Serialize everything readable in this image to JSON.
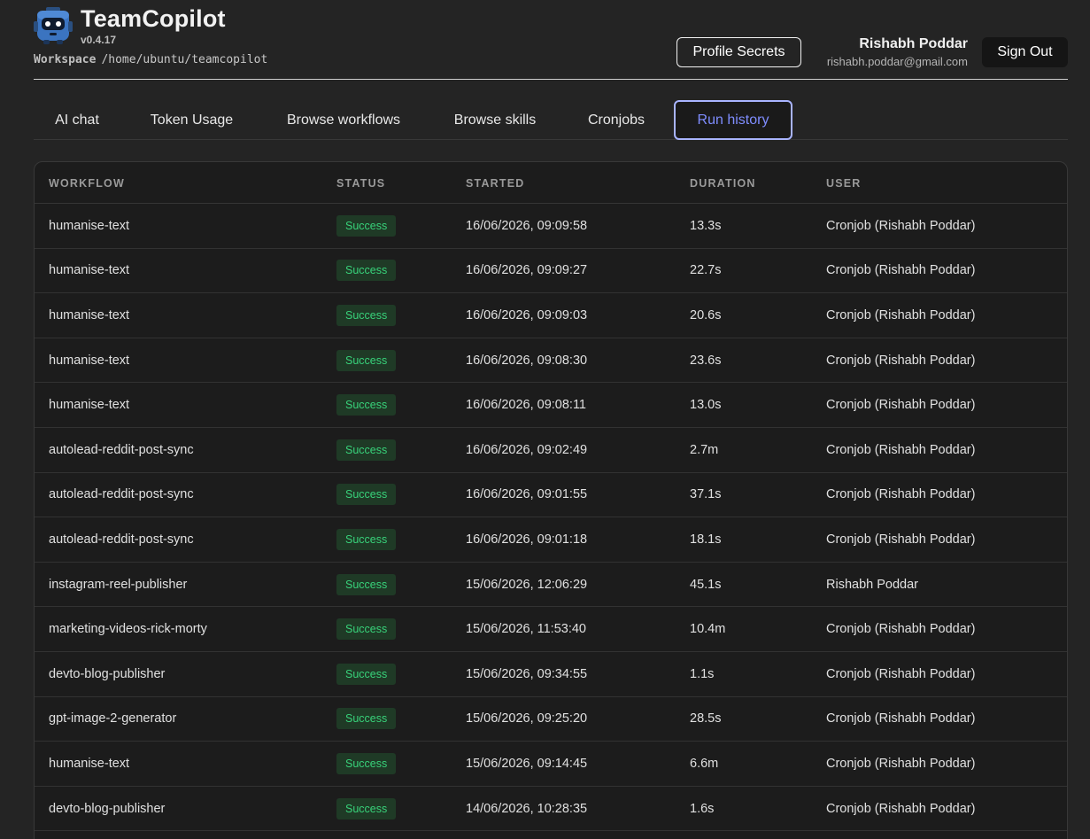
{
  "app": {
    "title": "TeamCopilot",
    "version": "v0.4.17",
    "workspace_label": "Workspace",
    "workspace_path": "/home/ubuntu/teamcopilot"
  },
  "header": {
    "profile_secrets_label": "Profile Secrets",
    "user_name": "Rishabh Poddar",
    "user_email": "rishabh.poddar@gmail.com",
    "sign_out_label": "Sign Out"
  },
  "tabs": [
    {
      "label": "AI chat",
      "active": false
    },
    {
      "label": "Token Usage",
      "active": false
    },
    {
      "label": "Browse workflows",
      "active": false
    },
    {
      "label": "Browse skills",
      "active": false
    },
    {
      "label": "Cronjobs",
      "active": false
    },
    {
      "label": "Run history",
      "active": true
    }
  ],
  "table": {
    "columns": [
      "WORKFLOW",
      "STATUS",
      "STARTED",
      "DURATION",
      "USER"
    ],
    "rows": [
      {
        "workflow": "humanise-text",
        "status": "Success",
        "started": "16/06/2026, 09:09:58",
        "duration": "13.3s",
        "user": "Cronjob (Rishabh Poddar)"
      },
      {
        "workflow": "humanise-text",
        "status": "Success",
        "started": "16/06/2026, 09:09:27",
        "duration": "22.7s",
        "user": "Cronjob (Rishabh Poddar)"
      },
      {
        "workflow": "humanise-text",
        "status": "Success",
        "started": "16/06/2026, 09:09:03",
        "duration": "20.6s",
        "user": "Cronjob (Rishabh Poddar)"
      },
      {
        "workflow": "humanise-text",
        "status": "Success",
        "started": "16/06/2026, 09:08:30",
        "duration": "23.6s",
        "user": "Cronjob (Rishabh Poddar)"
      },
      {
        "workflow": "humanise-text",
        "status": "Success",
        "started": "16/06/2026, 09:08:11",
        "duration": "13.0s",
        "user": "Cronjob (Rishabh Poddar)"
      },
      {
        "workflow": "autolead-reddit-post-sync",
        "status": "Success",
        "started": "16/06/2026, 09:02:49",
        "duration": "2.7m",
        "user": "Cronjob (Rishabh Poddar)"
      },
      {
        "workflow": "autolead-reddit-post-sync",
        "status": "Success",
        "started": "16/06/2026, 09:01:55",
        "duration": "37.1s",
        "user": "Cronjob (Rishabh Poddar)"
      },
      {
        "workflow": "autolead-reddit-post-sync",
        "status": "Success",
        "started": "16/06/2026, 09:01:18",
        "duration": "18.1s",
        "user": "Cronjob (Rishabh Poddar)"
      },
      {
        "workflow": "instagram-reel-publisher",
        "status": "Success",
        "started": "15/06/2026, 12:06:29",
        "duration": "45.1s",
        "user": "Rishabh Poddar"
      },
      {
        "workflow": "marketing-videos-rick-morty",
        "status": "Success",
        "started": "15/06/2026, 11:53:40",
        "duration": "10.4m",
        "user": "Cronjob (Rishabh Poddar)"
      },
      {
        "workflow": "devto-blog-publisher",
        "status": "Success",
        "started": "15/06/2026, 09:34:55",
        "duration": "1.1s",
        "user": "Cronjob (Rishabh Poddar)"
      },
      {
        "workflow": "gpt-image-2-generator",
        "status": "Success",
        "started": "15/06/2026, 09:25:20",
        "duration": "28.5s",
        "user": "Cronjob (Rishabh Poddar)"
      },
      {
        "workflow": "humanise-text",
        "status": "Success",
        "started": "15/06/2026, 09:14:45",
        "duration": "6.6m",
        "user": "Cronjob (Rishabh Poddar)"
      },
      {
        "workflow": "devto-blog-publisher",
        "status": "Success",
        "started": "14/06/2026, 10:28:35",
        "duration": "1.6s",
        "user": "Cronjob (Rishabh Poddar)"
      },
      {
        "workflow": "",
        "status": "",
        "started": "",
        "duration": "",
        "user": ""
      }
    ]
  },
  "colors": {
    "background": "#242424",
    "accent": "#7f8dff",
    "success_text": "#38d27a",
    "success_bg": "#1f3a26"
  }
}
